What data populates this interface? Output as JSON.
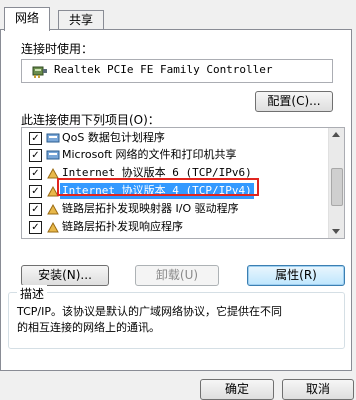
{
  "tabs": [
    {
      "label": "网络"
    },
    {
      "label": "共享"
    }
  ],
  "connect_using_label": "连接时使用：",
  "adapter_name": "Realtek PCIe FE Family Controller",
  "configure_button": "配置(C)...",
  "items_label": "此连接使用下列项目(O)：",
  "items": [
    {
      "label": "QoS 数据包计划程序",
      "icon": "qos-icon"
    },
    {
      "label": "Microsoft 网络的文件和打印机共享",
      "icon": "printer-share-icon"
    },
    {
      "label": "Internet 协议版本 6 (TCP/IPv6)",
      "icon": "protocol-icon"
    },
    {
      "label": "Internet 协议版本 4 (TCP/IPv4)",
      "icon": "protocol-icon"
    },
    {
      "label": "链路层拓扑发现映射器 I/O 驱动程序",
      "icon": "protocol-icon"
    },
    {
      "label": "链路层拓扑发现响应程序",
      "icon": "protocol-icon"
    }
  ],
  "install_button": "安装(N)...",
  "uninstall_button": "卸载(U)",
  "properties_button": "属性(R)",
  "description_title": "描述",
  "description_text_1": "TCP/IP。该协议是默认的广域网络协议，它提供在不同",
  "description_text_2": "的相互连接的网络上的通讯。",
  "ok_button": "确定",
  "cancel_button": "取消",
  "colors": {
    "selection": "#3399ff",
    "highlight_border": "#e0251f"
  }
}
